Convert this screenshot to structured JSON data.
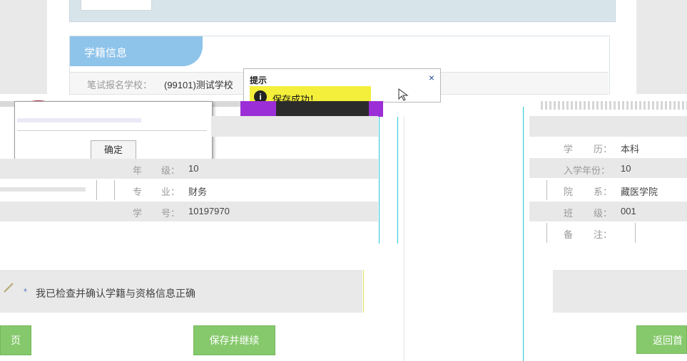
{
  "section": {
    "title": "学籍信息"
  },
  "exam_school": {
    "label": "笔试报名学校：",
    "value": "(99101)测试学校"
  },
  "dialog": {
    "title": "提示",
    "close_label": "×",
    "message": "保存成功！",
    "confirm_label": "确定"
  },
  "left_fields": [
    {
      "label_a": "年",
      "label_b": "级：",
      "value": "10"
    },
    {
      "label_a": "专",
      "label_b": "业：",
      "value": "财务"
    },
    {
      "label_a": "学",
      "label_b": "号：",
      "value": "10197970"
    }
  ],
  "right_fields": [
    {
      "label_a": "学",
      "label_b": "历：",
      "value": "本科"
    },
    {
      "label_a": "入学年份：",
      "label_b": "",
      "value": "10"
    },
    {
      "label_a": "院",
      "label_b": "系：",
      "value": "藏医学院"
    },
    {
      "label_a": "班",
      "label_b": "级：",
      "value": "001"
    },
    {
      "label_a": "备",
      "label_b": "注：",
      "value": ""
    }
  ],
  "confirm_check": {
    "text": "我已检查并确认学籍与资格信息正确",
    "required_mark": "*"
  },
  "buttons": {
    "prev": "页",
    "save_continue": "保存并继续",
    "back_home": "返回首"
  },
  "colors": {
    "accent_blue": "#8ec3ea",
    "green": "#86c96c",
    "dialog_yellow": "#f3ef3b",
    "glitch_magenta": "#9b2ed6"
  }
}
